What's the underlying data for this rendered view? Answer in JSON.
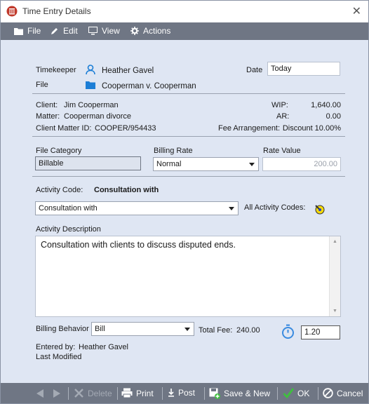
{
  "window": {
    "title": "Time Entry Details"
  },
  "menu": {
    "file": "File",
    "edit": "Edit",
    "view": "View",
    "actions": "Actions"
  },
  "header": {
    "timekeeper_label": "Timekeeper",
    "timekeeper_value": "Heather Gavel",
    "file_label": "File",
    "file_value": "Cooperman v. Cooperman",
    "date_label": "Date",
    "date_value": "Today"
  },
  "client_info": {
    "client_label": "Client:",
    "client_value": "Jim Cooperman",
    "matter_label": "Matter:",
    "matter_value": "Cooperman divorce",
    "cmid_label": "Client Matter ID:",
    "cmid_value": "COOPER/954433",
    "wip_label": "WIP:",
    "wip_value": "1,640.00",
    "ar_label": "AR:",
    "ar_value": "0.00",
    "fee_arr_label": "Fee Arrangement:",
    "fee_arr_value": "Discount 10.00%"
  },
  "billing": {
    "file_category_label": "File Category",
    "file_category_value": "Billable",
    "billing_rate_label": "Billing Rate",
    "billing_rate_value": "Normal",
    "rate_value_label": "Rate Value",
    "rate_value": "200.00"
  },
  "activity": {
    "code_label": "Activity Code:",
    "code_value": "Consultation with",
    "code_select": "Consultation with",
    "all_codes_label": "All Activity Codes:",
    "description_label": "Activity Description",
    "description": "Consultation with clients to discuss disputed ends."
  },
  "bottom": {
    "billing_behavior_label": "Billing Behavior",
    "billing_behavior_value": "Bill",
    "total_fee_label": "Total Fee:",
    "total_fee_value": "240.00",
    "hours": "1.20",
    "entered_by_label": "Entered by:",
    "entered_by_value": "Heather Gavel",
    "last_modified_label": "Last Modified"
  },
  "footer": {
    "delete": "Delete",
    "print": "Print",
    "post": "Post",
    "save_new": "Save & New",
    "ok": "OK",
    "cancel": "Cancel"
  },
  "colors": {
    "background": "#dfe6f3",
    "menubar": "#6f7684",
    "accent_blue": "#1c7ed6",
    "ok_green": "#3fbf3f",
    "brand_red": "#c0392b"
  }
}
